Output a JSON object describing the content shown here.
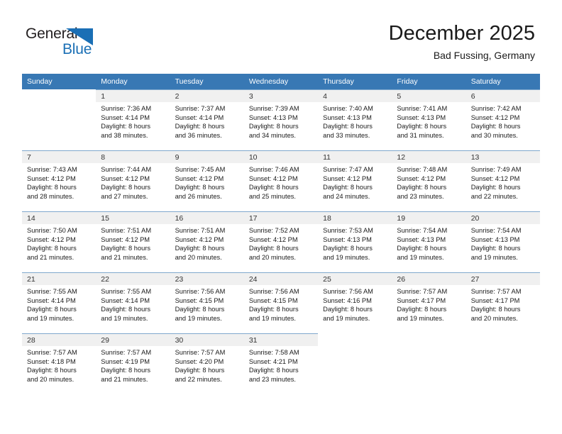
{
  "brand": {
    "name_part1": "General",
    "name_part2": "Blue",
    "triangle_color": "#1a6fb5"
  },
  "header": {
    "title": "December 2025",
    "subtitle": "Bad Fussing, Germany"
  },
  "colors": {
    "header_row": "#3878b4",
    "daynum_bar": "#f0f0f0",
    "cell_border": "#7fa8cd",
    "text": "#1a1a1a"
  },
  "weekdays": [
    "Sunday",
    "Monday",
    "Tuesday",
    "Wednesday",
    "Thursday",
    "Friday",
    "Saturday"
  ],
  "weeks": [
    [
      {
        "day": "",
        "sunrise": "",
        "sunset": "",
        "daylight1": "",
        "daylight2": ""
      },
      {
        "day": "1",
        "sunrise": "Sunrise: 7:36 AM",
        "sunset": "Sunset: 4:14 PM",
        "daylight1": "Daylight: 8 hours",
        "daylight2": "and 38 minutes."
      },
      {
        "day": "2",
        "sunrise": "Sunrise: 7:37 AM",
        "sunset": "Sunset: 4:14 PM",
        "daylight1": "Daylight: 8 hours",
        "daylight2": "and 36 minutes."
      },
      {
        "day": "3",
        "sunrise": "Sunrise: 7:39 AM",
        "sunset": "Sunset: 4:13 PM",
        "daylight1": "Daylight: 8 hours",
        "daylight2": "and 34 minutes."
      },
      {
        "day": "4",
        "sunrise": "Sunrise: 7:40 AM",
        "sunset": "Sunset: 4:13 PM",
        "daylight1": "Daylight: 8 hours",
        "daylight2": "and 33 minutes."
      },
      {
        "day": "5",
        "sunrise": "Sunrise: 7:41 AM",
        "sunset": "Sunset: 4:13 PM",
        "daylight1": "Daylight: 8 hours",
        "daylight2": "and 31 minutes."
      },
      {
        "day": "6",
        "sunrise": "Sunrise: 7:42 AM",
        "sunset": "Sunset: 4:12 PM",
        "daylight1": "Daylight: 8 hours",
        "daylight2": "and 30 minutes."
      }
    ],
    [
      {
        "day": "7",
        "sunrise": "Sunrise: 7:43 AM",
        "sunset": "Sunset: 4:12 PM",
        "daylight1": "Daylight: 8 hours",
        "daylight2": "and 28 minutes."
      },
      {
        "day": "8",
        "sunrise": "Sunrise: 7:44 AM",
        "sunset": "Sunset: 4:12 PM",
        "daylight1": "Daylight: 8 hours",
        "daylight2": "and 27 minutes."
      },
      {
        "day": "9",
        "sunrise": "Sunrise: 7:45 AM",
        "sunset": "Sunset: 4:12 PM",
        "daylight1": "Daylight: 8 hours",
        "daylight2": "and 26 minutes."
      },
      {
        "day": "10",
        "sunrise": "Sunrise: 7:46 AM",
        "sunset": "Sunset: 4:12 PM",
        "daylight1": "Daylight: 8 hours",
        "daylight2": "and 25 minutes."
      },
      {
        "day": "11",
        "sunrise": "Sunrise: 7:47 AM",
        "sunset": "Sunset: 4:12 PM",
        "daylight1": "Daylight: 8 hours",
        "daylight2": "and 24 minutes."
      },
      {
        "day": "12",
        "sunrise": "Sunrise: 7:48 AM",
        "sunset": "Sunset: 4:12 PM",
        "daylight1": "Daylight: 8 hours",
        "daylight2": "and 23 minutes."
      },
      {
        "day": "13",
        "sunrise": "Sunrise: 7:49 AM",
        "sunset": "Sunset: 4:12 PM",
        "daylight1": "Daylight: 8 hours",
        "daylight2": "and 22 minutes."
      }
    ],
    [
      {
        "day": "14",
        "sunrise": "Sunrise: 7:50 AM",
        "sunset": "Sunset: 4:12 PM",
        "daylight1": "Daylight: 8 hours",
        "daylight2": "and 21 minutes."
      },
      {
        "day": "15",
        "sunrise": "Sunrise: 7:51 AM",
        "sunset": "Sunset: 4:12 PM",
        "daylight1": "Daylight: 8 hours",
        "daylight2": "and 21 minutes."
      },
      {
        "day": "16",
        "sunrise": "Sunrise: 7:51 AM",
        "sunset": "Sunset: 4:12 PM",
        "daylight1": "Daylight: 8 hours",
        "daylight2": "and 20 minutes."
      },
      {
        "day": "17",
        "sunrise": "Sunrise: 7:52 AM",
        "sunset": "Sunset: 4:12 PM",
        "daylight1": "Daylight: 8 hours",
        "daylight2": "and 20 minutes."
      },
      {
        "day": "18",
        "sunrise": "Sunrise: 7:53 AM",
        "sunset": "Sunset: 4:13 PM",
        "daylight1": "Daylight: 8 hours",
        "daylight2": "and 19 minutes."
      },
      {
        "day": "19",
        "sunrise": "Sunrise: 7:54 AM",
        "sunset": "Sunset: 4:13 PM",
        "daylight1": "Daylight: 8 hours",
        "daylight2": "and 19 minutes."
      },
      {
        "day": "20",
        "sunrise": "Sunrise: 7:54 AM",
        "sunset": "Sunset: 4:13 PM",
        "daylight1": "Daylight: 8 hours",
        "daylight2": "and 19 minutes."
      }
    ],
    [
      {
        "day": "21",
        "sunrise": "Sunrise: 7:55 AM",
        "sunset": "Sunset: 4:14 PM",
        "daylight1": "Daylight: 8 hours",
        "daylight2": "and 19 minutes."
      },
      {
        "day": "22",
        "sunrise": "Sunrise: 7:55 AM",
        "sunset": "Sunset: 4:14 PM",
        "daylight1": "Daylight: 8 hours",
        "daylight2": "and 19 minutes."
      },
      {
        "day": "23",
        "sunrise": "Sunrise: 7:56 AM",
        "sunset": "Sunset: 4:15 PM",
        "daylight1": "Daylight: 8 hours",
        "daylight2": "and 19 minutes."
      },
      {
        "day": "24",
        "sunrise": "Sunrise: 7:56 AM",
        "sunset": "Sunset: 4:15 PM",
        "daylight1": "Daylight: 8 hours",
        "daylight2": "and 19 minutes."
      },
      {
        "day": "25",
        "sunrise": "Sunrise: 7:56 AM",
        "sunset": "Sunset: 4:16 PM",
        "daylight1": "Daylight: 8 hours",
        "daylight2": "and 19 minutes."
      },
      {
        "day": "26",
        "sunrise": "Sunrise: 7:57 AM",
        "sunset": "Sunset: 4:17 PM",
        "daylight1": "Daylight: 8 hours",
        "daylight2": "and 19 minutes."
      },
      {
        "day": "27",
        "sunrise": "Sunrise: 7:57 AM",
        "sunset": "Sunset: 4:17 PM",
        "daylight1": "Daylight: 8 hours",
        "daylight2": "and 20 minutes."
      }
    ],
    [
      {
        "day": "28",
        "sunrise": "Sunrise: 7:57 AM",
        "sunset": "Sunset: 4:18 PM",
        "daylight1": "Daylight: 8 hours",
        "daylight2": "and 20 minutes."
      },
      {
        "day": "29",
        "sunrise": "Sunrise: 7:57 AM",
        "sunset": "Sunset: 4:19 PM",
        "daylight1": "Daylight: 8 hours",
        "daylight2": "and 21 minutes."
      },
      {
        "day": "30",
        "sunrise": "Sunrise: 7:57 AM",
        "sunset": "Sunset: 4:20 PM",
        "daylight1": "Daylight: 8 hours",
        "daylight2": "and 22 minutes."
      },
      {
        "day": "31",
        "sunrise": "Sunrise: 7:58 AM",
        "sunset": "Sunset: 4:21 PM",
        "daylight1": "Daylight: 8 hours",
        "daylight2": "and 23 minutes."
      },
      {
        "day": "",
        "sunrise": "",
        "sunset": "",
        "daylight1": "",
        "daylight2": ""
      },
      {
        "day": "",
        "sunrise": "",
        "sunset": "",
        "daylight1": "",
        "daylight2": ""
      },
      {
        "day": "",
        "sunrise": "",
        "sunset": "",
        "daylight1": "",
        "daylight2": ""
      }
    ]
  ]
}
